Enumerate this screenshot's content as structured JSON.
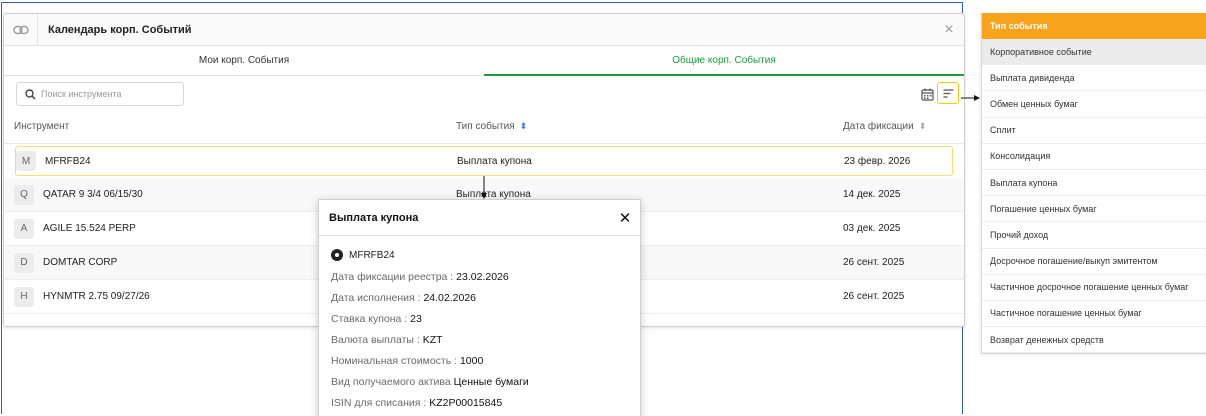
{
  "window": {
    "title": "Календарь корп. Событий",
    "close": "×"
  },
  "tabs": [
    {
      "label": "Мои корп. События",
      "active": false
    },
    {
      "label": "Общие корп. События",
      "active": true
    }
  ],
  "search": {
    "placeholder": "Поиск инструмента",
    "value": ""
  },
  "table": {
    "headers": {
      "instrument": "Инструмент",
      "event_type": "Тип события",
      "date": "Дата фиксации"
    },
    "rows": [
      {
        "letter": "M",
        "instrument": "MFRFB24",
        "event_type": "Выплата купона",
        "date": "23 февр. 2026"
      },
      {
        "letter": "Q",
        "instrument": "QATAR 9 3/4 06/15/30",
        "event_type": "Выплата купона",
        "date": "14 дек. 2025"
      },
      {
        "letter": "A",
        "instrument": "AGILE 15.524 PERP",
        "event_type": "",
        "date": "03 дек. 2025"
      },
      {
        "letter": "D",
        "instrument": "DOMTAR CORP",
        "event_type": "",
        "date": "26 сент. 2025"
      },
      {
        "letter": "H",
        "instrument": "HYNMTR 2.75 09/27/26",
        "event_type": "",
        "date": "26 сент. 2025"
      }
    ]
  },
  "popup": {
    "title": "Выплата купона",
    "close": "✕",
    "instrument": "MFRFB24",
    "fields": [
      {
        "key": "Дата фиксации реестра : ",
        "value": "23.02.2026"
      },
      {
        "key": "Дата исполнения : ",
        "value": "24.02.2026"
      },
      {
        "key": "Ставка купона : ",
        "value": "23"
      },
      {
        "key": "Валюта выплаты : ",
        "value": "KZT"
      },
      {
        "key": "Номинальная стоимость : ",
        "value": "1000"
      },
      {
        "key": "Вид получаемого актива ",
        "value": "Ценные бумаги"
      },
      {
        "key": "ISIN для списания : ",
        "value": "KZ2P00015845"
      }
    ]
  },
  "dropdown": {
    "header": "Тип события",
    "items": [
      "Корпоративное событие",
      "Выплата дивиденда",
      "Обмен ценных бумаг",
      "Сплит",
      "Консолидация",
      "Выплата купона",
      "Погашение ценных бумаг",
      "Прочий доход",
      "Досрочное погашение/выкуп эмитентом",
      "Частичное досрочное погашение ценных бумаг",
      "Частичное погашение ценных бумаг",
      "Возврат денежных средств"
    ]
  },
  "icons": {
    "link": "link-icon",
    "search": "search-icon",
    "calendar": "calendar-icon",
    "filter": "filter-icon",
    "sort": "sort-icon"
  },
  "colors": {
    "accent_green": "#1a9e3a",
    "highlight_yellow": "#f2d000",
    "dropdown_header": "#f7a31c",
    "sort_active": "#2b7de9",
    "annotation_blue": "#2f5fb3"
  }
}
